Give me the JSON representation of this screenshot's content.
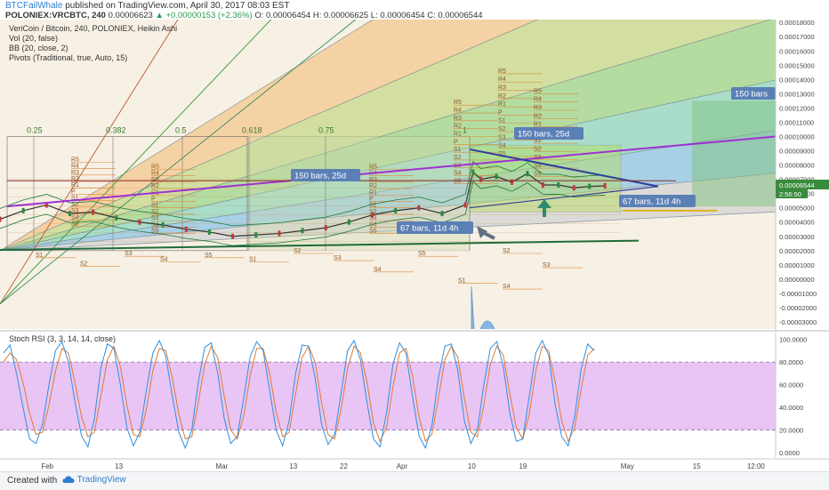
{
  "header": {
    "author": "BTCFailWhale",
    "published_text": "published on TradingView.com, April 30, 2017 08:03 EST",
    "symbol": "POLONIEX:VRCBTC, 240",
    "last": "0.00006623",
    "change": "+0.00000153 (+2.36%)",
    "ohlc": "O: 0.00006454 H: 0.00006625 L: 0.00006454 C: 0.00006544"
  },
  "legend": {
    "title": "VeriCoin / Bitcoin, 240, POLONIEX, Heikin Ashi",
    "vol": "Vol (20, false)",
    "bb": "BB (20, close, 2)",
    "pivots": "Pivots (Traditional, true, Auto, 15)"
  },
  "rsi_legend": "Stoch RSI (3, 3, 14, 14, close)",
  "footer": {
    "created_with": "Created with",
    "brand": "TradingView"
  },
  "colors": {
    "fib_fills": [
      "#f4c88f",
      "#c6d98a",
      "#9fd58a",
      "#8fd7c1",
      "#8ec6e6",
      "#d3d3d3"
    ],
    "price_tag": "#3a8b3e",
    "rsi_band": "#e8c5f5",
    "k_line": "#2f8fe0",
    "d_line": "#e07a2f",
    "label_box": "#5b80b5"
  },
  "chart_data": [
    {
      "type": "line",
      "title": "VeriCoin / Bitcoin, 240, POLONIEX, Heikin Ashi",
      "y_ticks": [
        "0.00018000",
        "0.00017000",
        "0.00016000",
        "0.00015000",
        "0.00014000",
        "0.00013000",
        "0.00012000",
        "0.00011000",
        "0.00010000",
        "0.00009000",
        "0.00008000",
        "0.00007000",
        "0.00006000",
        "0.00005000",
        "0.00004000",
        "0.00003000",
        "0.00002000",
        "0.00001000",
        "0.00000000",
        "-0.00001000",
        "-0.00002000",
        "-0.00003000"
      ],
      "ylim": [
        -3.5e-05,
        0.000182
      ],
      "x_ticks": [
        {
          "label": "Feb",
          "t": 0.06
        },
        {
          "label": "13",
          "t": 0.155
        },
        {
          "label": "Mar",
          "t": 0.285
        },
        {
          "label": "13",
          "t": 0.38
        },
        {
          "label": "22",
          "t": 0.445
        },
        {
          "label": "Apr",
          "t": 0.518
        },
        {
          "label": "10",
          "t": 0.61
        },
        {
          "label": "19",
          "t": 0.676
        },
        {
          "label": "May",
          "t": 0.807
        },
        {
          "label": "15",
          "t": 0.9
        },
        {
          "label": "12:00",
          "t": 0.97
        }
      ],
      "last_price_tag": "0.00006544",
      "countdown_tag": "2:56:50",
      "fib_fan_labels": [
        "0.25",
        "0.382",
        "0.5",
        "0.618",
        "0.75",
        "1"
      ],
      "bar_count_labels": [
        "150 bars, 25d",
        "150 bars, 25d",
        "67 bars, 11d 4h",
        "67 bars, 11d 4h",
        "150 bars"
      ],
      "pivot_labels": [
        "R5",
        "R4",
        "R3",
        "R2",
        "R1",
        "P",
        "S1",
        "S2",
        "S3",
        "S4",
        "S5"
      ],
      "price_path": [
        [
          0.0,
          4.2e-05
        ],
        [
          0.03,
          4.8e-05
        ],
        [
          0.06,
          5.2e-05
        ],
        [
          0.09,
          4.6e-05
        ],
        [
          0.12,
          4.7e-05
        ],
        [
          0.15,
          4.3e-05
        ],
        [
          0.18,
          4e-05
        ],
        [
          0.21,
          3.8e-05
        ],
        [
          0.24,
          3.5e-05
        ],
        [
          0.27,
          3.3e-05
        ],
        [
          0.3,
          3e-05
        ],
        [
          0.33,
          3.1e-05
        ],
        [
          0.36,
          3.2e-05
        ],
        [
          0.39,
          3.4e-05
        ],
        [
          0.42,
          3.6e-05
        ],
        [
          0.45,
          4e-05
        ],
        [
          0.48,
          4.5e-05
        ],
        [
          0.51,
          4.8e-05
        ],
        [
          0.54,
          5e-05
        ],
        [
          0.57,
          4.6e-05
        ],
        [
          0.6,
          5.2e-05
        ],
        [
          0.61,
          7.5e-05
        ],
        [
          0.62,
          7e-05
        ],
        [
          0.64,
          7.2e-05
        ],
        [
          0.66,
          6.8e-05
        ],
        [
          0.68,
          7.4e-05
        ],
        [
          0.7,
          6.6e-05
        ],
        [
          0.72,
          6.6e-05
        ],
        [
          0.74,
          6.4e-05
        ],
        [
          0.76,
          6.5e-05
        ],
        [
          0.78,
          6.54e-05
        ]
      ]
    },
    {
      "type": "line",
      "title": "Stoch RSI (3, 3, 14, 14, close)",
      "y_ticks": [
        "100.0000",
        "80.0000",
        "60.0000",
        "40.0000",
        "20.0000",
        "0.0000"
      ],
      "ylim": [
        -4,
        106
      ],
      "bands": [
        20,
        80
      ],
      "k_series": [
        88,
        95,
        70,
        40,
        12,
        8,
        25,
        60,
        90,
        98,
        80,
        45,
        15,
        5,
        30,
        75,
        96,
        92,
        60,
        22,
        6,
        18,
        55,
        88,
        99,
        85,
        50,
        18,
        4,
        20,
        62,
        93,
        97,
        70,
        30,
        8,
        14,
        48,
        85,
        98,
        90,
        55,
        20,
        6,
        28,
        70,
        95,
        94,
        66,
        25,
        7,
        16,
        52,
        90,
        99,
        82,
        44,
        12,
        5,
        35,
        78,
        97,
        88,
        50,
        15,
        4,
        24,
        66,
        94,
        96,
        72,
        28,
        8,
        20,
        60,
        92,
        98,
        76,
        35,
        10,
        12,
        50,
        88,
        99,
        86,
        42,
        14,
        6,
        32,
        74,
        96,
        90
      ],
      "d_series": [
        80,
        88,
        82,
        62,
        35,
        16,
        18,
        42,
        72,
        92,
        88,
        62,
        32,
        14,
        18,
        50,
        82,
        94,
        76,
        42,
        16,
        14,
        38,
        72,
        92,
        90,
        66,
        34,
        12,
        14,
        44,
        78,
        94,
        84,
        50,
        20,
        12,
        32,
        68,
        92,
        92,
        70,
        36,
        14,
        18,
        52,
        84,
        94,
        80,
        44,
        16,
        12,
        38,
        74,
        94,
        88,
        62,
        26,
        10,
        22,
        58,
        88,
        92,
        68,
        32,
        10,
        16,
        48,
        82,
        94,
        84,
        48,
        18,
        14,
        42,
        78,
        94,
        86,
        52,
        22,
        12,
        34,
        72,
        94,
        90,
        62,
        28,
        10,
        22,
        56,
        86,
        92
      ]
    }
  ]
}
